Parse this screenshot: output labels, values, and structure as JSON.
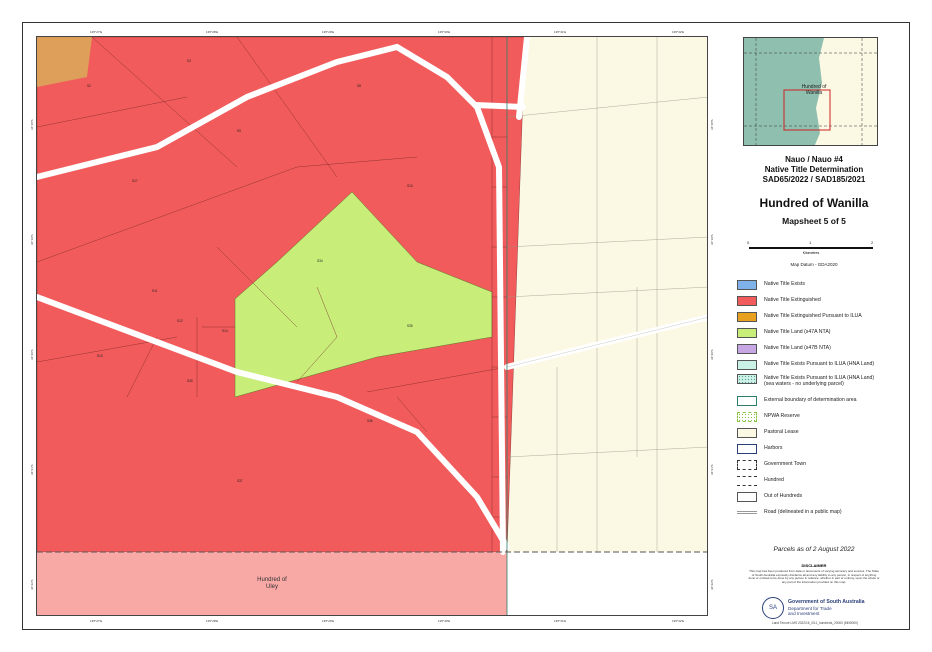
{
  "map": {
    "hundred_south_label": "Hundred of\nUley",
    "top_ticks": [
      "135°27'E",
      "135°28'E",
      "135°29'E",
      "135°30'E",
      "135°31'E",
      "135°32'E"
    ],
    "bottom_ticks": [
      "135°27'E",
      "135°28'E",
      "135°29'E",
      "135°30'E",
      "135°31'E",
      "135°32'E"
    ],
    "left_ticks": [
      "34°18'S",
      "34°19'S",
      "34°20'S",
      "34°21'S",
      "34°22'S"
    ],
    "right_ticks": [
      "34°18'S",
      "34°19'S",
      "34°20'S",
      "34°21'S",
      "34°22'S"
    ],
    "parcel_labels": [
      "S2",
      "S3",
      "S8",
      "S9",
      "S17",
      "S10",
      "S11",
      "S12",
      "S13",
      "S14",
      "S30",
      "S34",
      "S35",
      "S36",
      "S37"
    ]
  },
  "inset": {
    "label": "Hundred of\nWanilla",
    "colors": {
      "sea": "#8fbfae",
      "land": "#fbf8e4",
      "box": "#cc2222"
    }
  },
  "title": {
    "line1": "Nauo / Nauo #4",
    "line2": "Native Title Determination",
    "line3": "SAD65/2022 / SAD185/2021",
    "hundred": "Hundred of Wanilla",
    "mapsheet": "Mapsheet 5 of 5"
  },
  "scale": {
    "t0": "0",
    "t1": "1",
    "t2": "2",
    "unit": "Kilometres"
  },
  "datum": "Map Datum - GDA2020",
  "legend": [
    {
      "label": "Native Title Exists",
      "icon": "blue-fill",
      "color": "#7fb2e8"
    },
    {
      "label": "Native Title Extinguished",
      "icon": "red-fill",
      "color": "#f25b5b"
    },
    {
      "label": "Native Title Extinguished Pursuant to ILUA",
      "icon": "orange-fill",
      "color": "#e8a11e"
    },
    {
      "label": "Native Title Land (s47A NTA)",
      "icon": "green-fill",
      "color": "#c8ed78"
    },
    {
      "label": "Native Title Land (s47B NTA)",
      "icon": "purple-fill",
      "color": "#c6a6e3"
    },
    {
      "label": "Native Title Exists Pursuant to ILUA (HNA Land)",
      "icon": "mint-fill",
      "color": "#c9f1e6"
    },
    {
      "label": "Native Title Exists Pursuant to ILUA (HNA Land)\n(sea waters - no underlying parcel)",
      "icon": "mint-dotted-fill",
      "color": "#c9f1e6"
    },
    {
      "label": "External boundary of determination area",
      "icon": "teal-outline",
      "color": "#2e7d6b"
    },
    {
      "label": "NPWA Reserve",
      "icon": "green-dashed-outline",
      "color": "#8bc34a"
    },
    {
      "label": "Pastoral Lease",
      "icon": "cream-fill",
      "color": "#fbf8e4"
    },
    {
      "label": "Harbors",
      "icon": "navy-outline",
      "color": "#2a3f7a"
    },
    {
      "label": "Government Town",
      "icon": "dashed-outline",
      "color": "#333333"
    },
    {
      "label": "Hundred",
      "icon": "long-dashed-outline",
      "color": "#333333"
    },
    {
      "label": "Out of Hundreds",
      "icon": "grey-outline",
      "color": "#555555"
    },
    {
      "label": "Road (delineated in a public map)",
      "icon": "road-line",
      "color": "#bbbbbb"
    }
  ],
  "parcels_as_of": "Parcels as of 2 August 2022",
  "disclaimer": {
    "heading": "DISCLAIMER",
    "text": "This map has been produced from data or documents of varying accuracy and sources. The State of South Australia expressly disclaims all and any liability to any person, in respect of anything done or omitted to be done by any person in reliance, whether in part or entirety, upon the whole or any part of the information provided on this map."
  },
  "government": {
    "name": "Government of South Australia",
    "dept": "Department for Trade\nand Investment",
    "seal": "SA"
  },
  "footer": "Land Tenure LMS  2022/16_0/11_hundreds_20000 (MN0000)",
  "colors": {
    "extinguished": "#f25b5b",
    "s47a": "#c8ed78",
    "pastoral": "#fbf8e4",
    "south": "#f8a9a6",
    "road": "#ffffff"
  }
}
